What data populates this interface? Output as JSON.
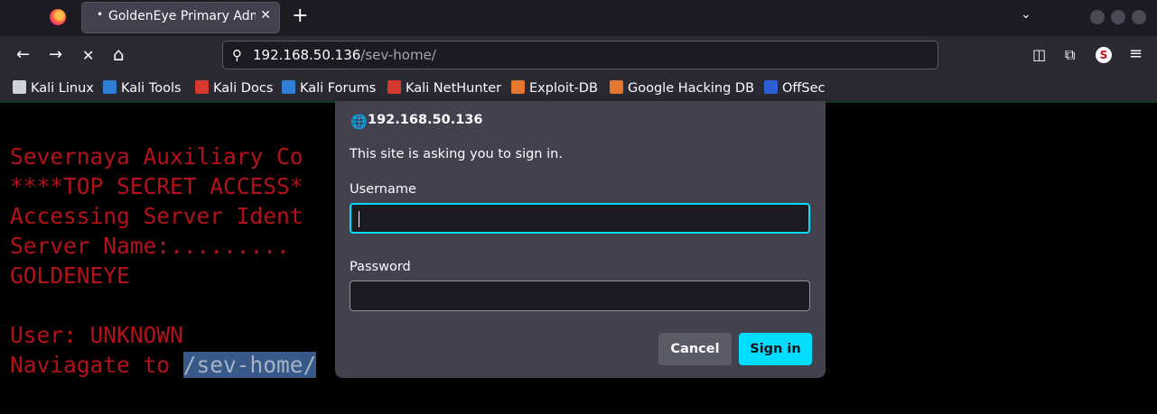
{
  "tab": {
    "title": "GoldenEye Primary Admin Server",
    "dot": "•",
    "close": "✕"
  },
  "tabstrip": {
    "new_tab": "+",
    "list_all_tabs": "⌄"
  },
  "nav": {
    "back": "←",
    "forward": "→",
    "stop": "✕",
    "home": "⌂",
    "url_search_icon": "⚲",
    "url_host": "192.168.50.136",
    "url_path": "/sev-home/",
    "pocket": "◫",
    "extensions": "⧉",
    "account": "S",
    "menu": "≡"
  },
  "bookmarks": [
    {
      "label": "Kali Linux",
      "color": "#cfd3da"
    },
    {
      "label": "Kali Tools",
      "color": "#2f7fd6"
    },
    {
      "label": "Kali Docs",
      "color": "#d63a2f"
    },
    {
      "label": "Kali Forums",
      "color": "#2f7fd6"
    },
    {
      "label": "Kali NetHunter",
      "color": "#d63a2f"
    },
    {
      "label": "Exploit-DB",
      "color": "#e4782f"
    },
    {
      "label": "Google Hacking DB",
      "color": "#e4782f"
    },
    {
      "label": "OffSec",
      "color": "#2f5fd6"
    }
  ],
  "terminal": {
    "line1": "Severnaya Auxiliary Co",
    "line2": "****TOP SECRET ACCESS*",
    "line3": "Accessing Server Ident",
    "line4": "Server Name:.........",
    "line5": "GOLDENEYE",
    "line6": "User: UNKNOWN",
    "line7_prefix": "Naviagate to ",
    "line7_link": "/sev-home/"
  },
  "dialog": {
    "globe_icon": "🌐",
    "host": "192.168.50.136",
    "message": "This site is asking you to sign in.",
    "username_label": "Username",
    "username_value": "",
    "password_label": "Password",
    "password_value": "",
    "cancel_label": "Cancel",
    "signin_label": "Sign in"
  },
  "colors": {
    "accent": "#00ddff",
    "terminal_red": "#b3121a",
    "selection": "#37598a"
  }
}
